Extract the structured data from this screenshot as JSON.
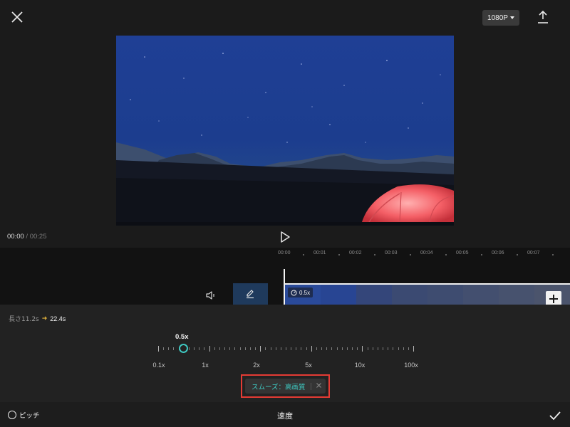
{
  "header": {
    "close_icon": "close-icon",
    "resolution_label": "1080P",
    "export_icon": "upload-icon"
  },
  "preview": {
    "scene": "starry night sky over mountains with red tent"
  },
  "playback": {
    "current_time": "00:00",
    "separator": "/",
    "total_time": "00:25",
    "play_icon": "play-icon"
  },
  "timeline": {
    "ruler_ticks": [
      "00:00",
      "00:01",
      "00:02",
      "00:03",
      "00:04",
      "00:05",
      "00:06",
      "00:07"
    ],
    "clip_speed_badge": "0.5x",
    "mute_icon": "speaker-mute-icon",
    "edit_icon": "pencil-icon",
    "add_icon": "plus-icon"
  },
  "speed_panel": {
    "duration_label": "長さ11.2s",
    "duration_new": "22.4s",
    "current_speed": "0.5x",
    "speed_fraction": 0.1,
    "scale_labels": [
      "0.1x",
      "1x",
      "2x",
      "5x",
      "10x",
      "100x"
    ],
    "smooth_label": "スムーズ：高画質",
    "accent_color": "#3ec7c0",
    "highlight_color": "#e53b34"
  },
  "bottom_bar": {
    "pitch_label": "ピッチ",
    "title": "速度",
    "confirm_icon": "checkmark-icon"
  }
}
